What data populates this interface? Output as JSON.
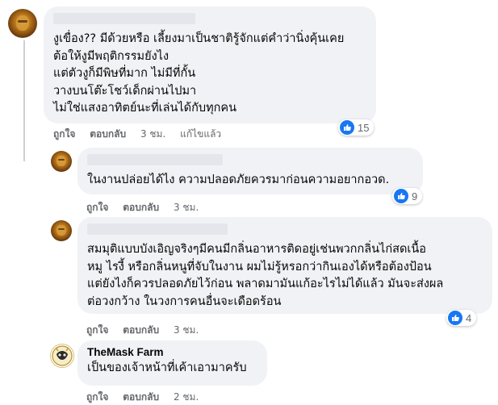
{
  "comments": [
    {
      "lines": [
        "งูเขื่อง?? มีด้วยหรือ เลี้ยงมาเป็นชาติรู้จักแต่คำว่านิ่งคุ้นเคย",
        "ต้อให้งูมีพฤติกรรมยังไง",
        "แต่ตัวงูก็มีพิษที่มาก ไม่มีที่กั้น",
        "วางบนโต๊ะโชว์เด็กผ่านไปมา",
        "ไม่ใช่แสงอาทิตย์นะที่เล่นได้กับทุกคน"
      ],
      "like_label": "ถูกใจ",
      "reply_label": "ตอบกลับ",
      "time": "3 ชม.",
      "edited_label": "แก้ไขแล้ว",
      "reaction_count": "15"
    },
    {
      "lines": [
        "ในงานปล่อยได้ไง ความปลอดภัยควรมาก่อนความอยากอวด."
      ],
      "like_label": "ถูกใจ",
      "reply_label": "ตอบกลับ",
      "time": "3 ชม.",
      "reaction_count": "9"
    },
    {
      "lines": [
        "สมมุติแบบบังเอิญจริงๆมีคนมีกลิ่นอาหารติดอยู่เช่นพวกกลิ่นไก่สดเนื้อ",
        "หมู ไรงี้ หรือกลิ่นหนูที่จับในงาน ผมไม่รู้หรอกว่ากินเองได้หรือต้องป้อน",
        "แต่ยังไงก็ควรปลอดภัยไว้ก่อน พลาดมามันแก้อะไรไม่ได้แล้ว มันจะส่งผล",
        "ต่อวงกว้าง ในวงการคนอื่นจะเดือดร้อน"
      ],
      "like_label": "ถูกใจ",
      "reply_label": "ตอบกลับ",
      "time": "3 ชม.",
      "reaction_count": "4"
    },
    {
      "author": "TheMask Farm",
      "lines": [
        "เป็นของเจ้าหน้าที่เค้าเอามาครับ"
      ],
      "like_label": "ถูกใจ",
      "reply_label": "ตอบกลับ",
      "time": "2 ชม."
    }
  ],
  "colors": {
    "like_blue": "#1877f2",
    "bubble": "#f0f2f5",
    "meta": "#65676b"
  },
  "icons": {
    "reaction": "like-thumb-icon"
  }
}
